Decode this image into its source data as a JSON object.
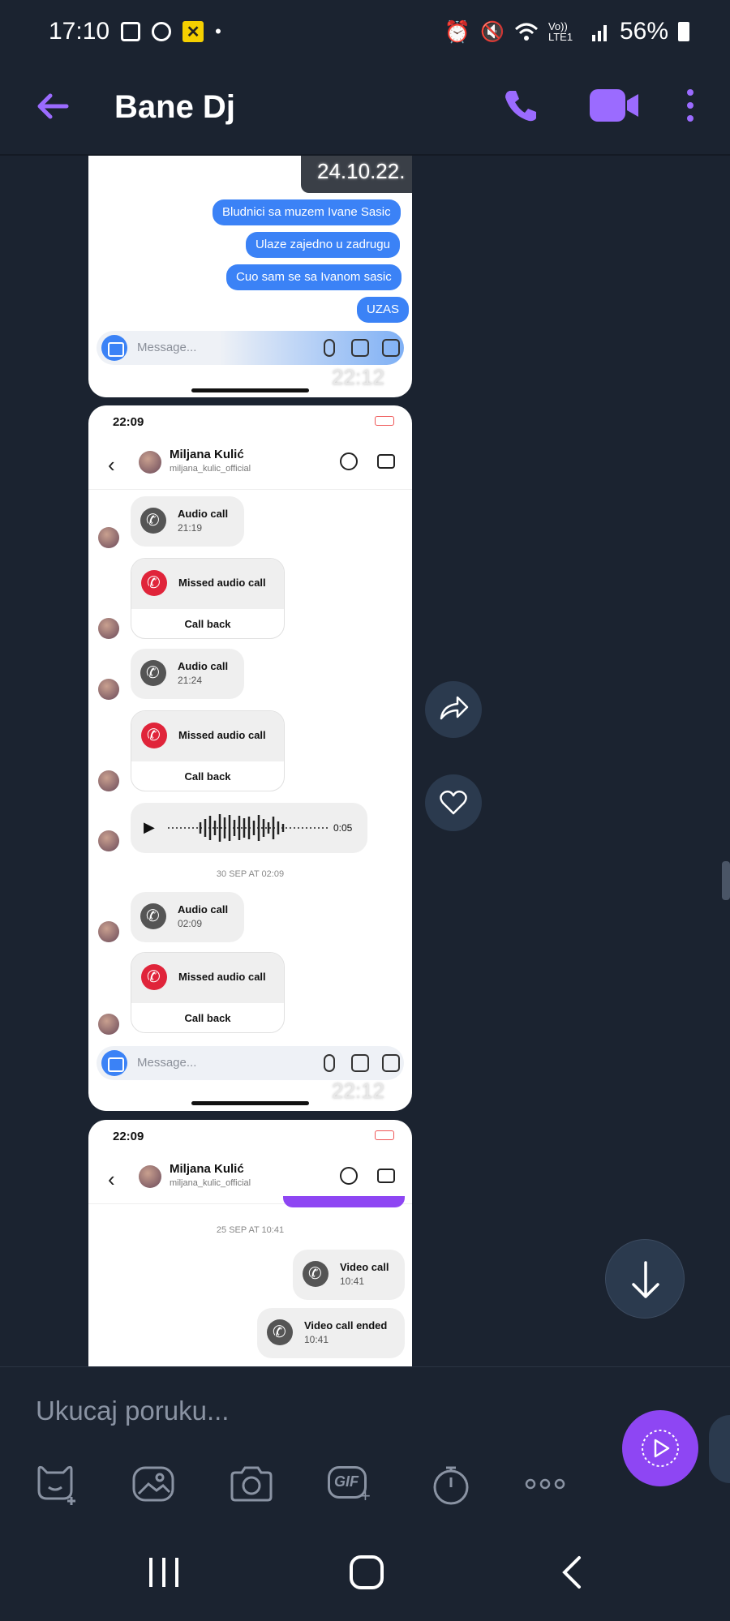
{
  "status": {
    "time": "17:10",
    "battery": "56%",
    "network": "Vo)) LTE1"
  },
  "header": {
    "title": "Bane Dj"
  },
  "shot1": {
    "date": "24.10.22.",
    "bubbles": [
      "Bludnici sa muzem Ivane Sasic",
      "Ulaze zajedno u zadrugu",
      "Cuo sam se sa Ivanom sasic",
      "UZAS"
    ],
    "message_placeholder": "Message...",
    "timestamp": "22:12"
  },
  "shot2": {
    "time": "22:09",
    "contact_name": "Miljana Kulić",
    "contact_user": "miljana_kulic_official",
    "calls": [
      {
        "title": "Audio call",
        "time": "21:19"
      },
      {
        "title": "Missed audio call",
        "action": "Call back"
      },
      {
        "title": "Audio call",
        "time": "21:24"
      },
      {
        "title": "Missed audio call",
        "action": "Call back"
      },
      {
        "title": "Audio call",
        "time": "02:09"
      },
      {
        "title": "Missed audio call",
        "action": "Call back"
      }
    ],
    "voice_duration": "0:05",
    "date_sep": "30 SEP AT 02:09",
    "message_placeholder": "Message...",
    "timestamp": "22:12"
  },
  "shot3": {
    "time": "22:09",
    "contact_name": "Miljana Kulić",
    "contact_user": "miljana_kulic_official",
    "date_sep": "25 SEP AT 10:41",
    "video_call": {
      "title": "Video call",
      "time": "10:41"
    },
    "video_ended": {
      "title": "Video call ended",
      "time": "10:41"
    }
  },
  "composer": {
    "placeholder": "Ukucaj poruku...",
    "gif_label": "GIF"
  },
  "colors": {
    "accent": "#8e46f3",
    "bg": "#1b2330",
    "ig_blue": "#3b82f6",
    "missed_red": "#e0243a"
  }
}
